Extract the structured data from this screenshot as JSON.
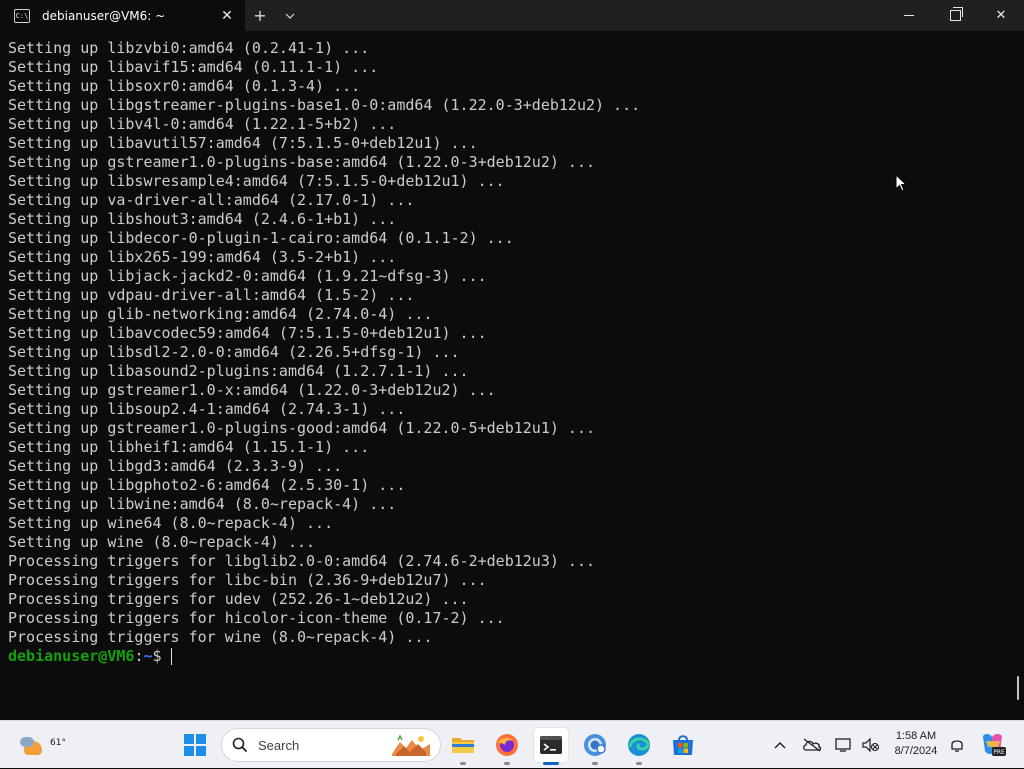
{
  "window": {
    "tab_title": "debianuser@VM6: ~",
    "tab_icon_text": "C:\\",
    "new_tab_label": "+",
    "dropdown_label": "⌄",
    "close_tab_label": "✕",
    "close_window_label": "✕"
  },
  "terminal": {
    "lines": [
      "Setting up libzvbi0:amd64 (0.2.41-1) ...",
      "Setting up libavif15:amd64 (0.11.1-1) ...",
      "Setting up libsoxr0:amd64 (0.1.3-4) ...",
      "Setting up libgstreamer-plugins-base1.0-0:amd64 (1.22.0-3+deb12u2) ...",
      "Setting up libv4l-0:amd64 (1.22.1-5+b2) ...",
      "Setting up libavutil57:amd64 (7:5.1.5-0+deb12u1) ...",
      "Setting up gstreamer1.0-plugins-base:amd64 (1.22.0-3+deb12u2) ...",
      "Setting up libswresample4:amd64 (7:5.1.5-0+deb12u1) ...",
      "Setting up va-driver-all:amd64 (2.17.0-1) ...",
      "Setting up libshout3:amd64 (2.4.6-1+b1) ...",
      "Setting up libdecor-0-plugin-1-cairo:amd64 (0.1.1-2) ...",
      "Setting up libx265-199:amd64 (3.5-2+b1) ...",
      "Setting up libjack-jackd2-0:amd64 (1.9.21~dfsg-3) ...",
      "Setting up vdpau-driver-all:amd64 (1.5-2) ...",
      "Setting up glib-networking:amd64 (2.74.0-4) ...",
      "Setting up libavcodec59:amd64 (7:5.1.5-0+deb12u1) ...",
      "Setting up libsdl2-2.0-0:amd64 (2.26.5+dfsg-1) ...",
      "Setting up libasound2-plugins:amd64 (1.2.7.1-1) ...",
      "Setting up gstreamer1.0-x:amd64 (1.22.0-3+deb12u2) ...",
      "Setting up libsoup2.4-1:amd64 (2.74.3-1) ...",
      "Setting up gstreamer1.0-plugins-good:amd64 (1.22.0-5+deb12u1) ...",
      "Setting up libheif1:amd64 (1.15.1-1) ...",
      "Setting up libgd3:amd64 (2.3.3-9) ...",
      "Setting up libgphoto2-6:amd64 (2.5.30-1) ...",
      "Setting up libwine:amd64 (8.0~repack-4) ...",
      "Setting up wine64 (8.0~repack-4) ...",
      "Setting up wine (8.0~repack-4) ...",
      "Processing triggers for libglib2.0-0:amd64 (2.74.6-2+deb12u3) ...",
      "Processing triggers for libc-bin (2.36-9+deb12u7) ...",
      "Processing triggers for udev (252.26-1~deb12u2) ...",
      "Processing triggers for hicolor-icon-theme (0.17-2) ...",
      "Processing triggers for wine (8.0~repack-4) ..."
    ],
    "prompt_user": "debianuser@VM6",
    "prompt_sep": ":",
    "prompt_path": "~",
    "prompt_symbol": "$"
  },
  "taskbar": {
    "weather_temp": "61°",
    "search_placeholder": "Search",
    "apps": [
      "start-icon",
      "file-explorer-icon",
      "firefox-icon",
      "terminal-icon",
      "chrome-icon",
      "edge-icon",
      "store-icon"
    ],
    "clock_time": "1:58 AM",
    "clock_date": "8/7/2024",
    "copilot_badge": "PRE"
  },
  "colors": {
    "terminal_bg": "#0c0c0c",
    "terminal_text": "#cccccc",
    "prompt_green": "#13a10e",
    "prompt_blue": "#3b78ff",
    "taskbar_bg": "#eef0f5"
  }
}
